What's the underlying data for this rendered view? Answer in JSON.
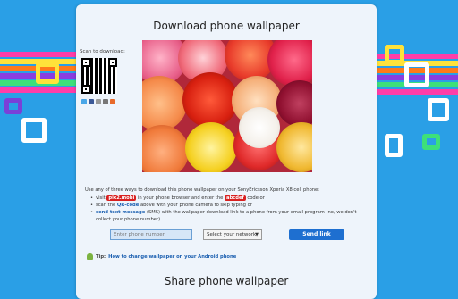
{
  "page": {
    "title": "Download phone wallpaper",
    "scan_label": "Scan to download:",
    "share_title": "Share phone wallpaper"
  },
  "instructions": {
    "intro": "Use any of three ways to download this phone wallpaper on your SonyEricsson Xperia X8 cell phone:",
    "item1_prefix": "visit",
    "item1_site": "pix2.mobi",
    "item1_middle": "in your phone browser and enter the",
    "item1_code": "abcdef",
    "item1_suffix": "code or",
    "item2_prefix": "scan the",
    "item2_link": "QR-code",
    "item2_suffix": "above with your phone camera to skip typing or",
    "item3_link": "send text message",
    "item3_suffix": "(SMS) with the wallpaper download link to a phone from your email program (no, we don't collect your phone number)"
  },
  "form": {
    "phone_placeholder": "Enter phone number",
    "network_value": "Select your network:",
    "send_label": "Send link"
  },
  "tip": {
    "label": "Tip:",
    "text": "How to change wallpaper on your Android phone"
  },
  "icons": {
    "share": [
      "twitter-icon",
      "facebook-icon",
      "mail-icon",
      "print-icon",
      "plus-icon"
    ],
    "android": "android-icon",
    "dropdown": "chevron-down-icon"
  },
  "colors": {
    "background": "#2a9fe6",
    "panel": "#eef4fb",
    "code_badge": "#d82020",
    "send_button": "#1e6fd0",
    "link": "#1b5fb0"
  }
}
